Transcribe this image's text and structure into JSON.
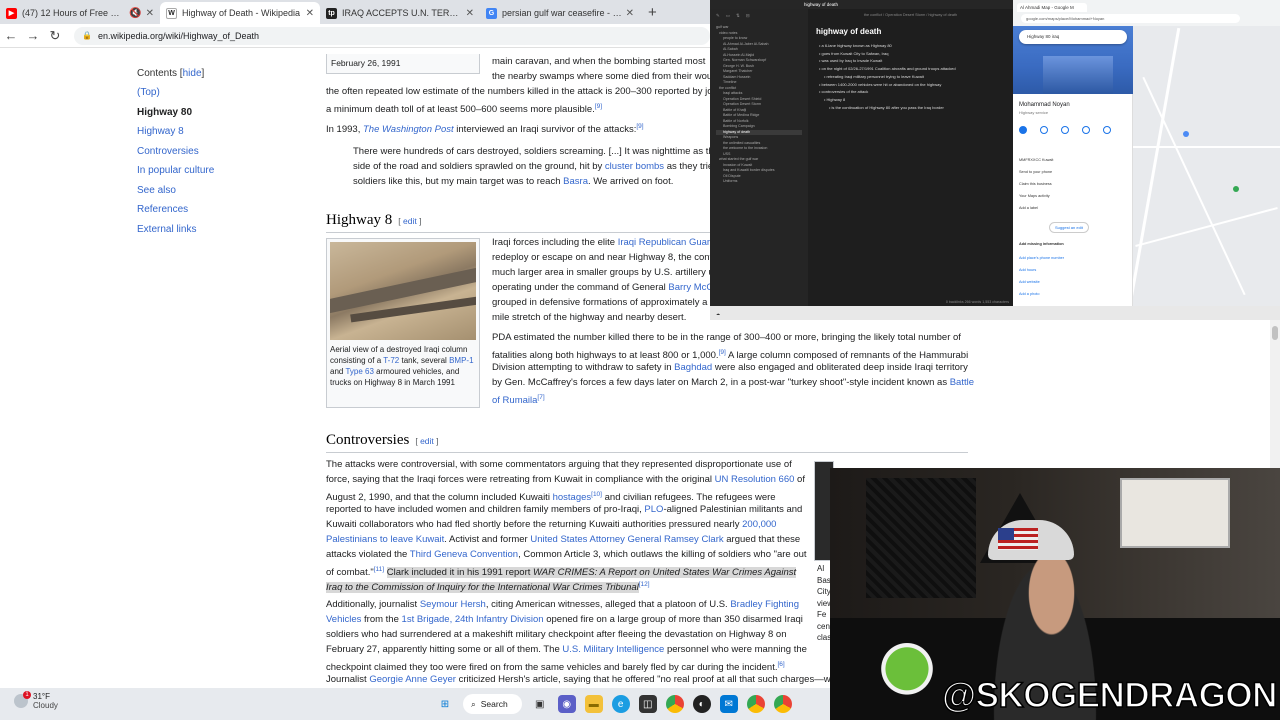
{
  "browser": {
    "tabs": [
      {
        "title": "(47) 12 Hours of Free Backg",
        "color": "#ff0000",
        "glyph": "▶"
      },
      {
        "title": "Highway of Death - Wikipedia",
        "color": "#555555",
        "glyph": "W"
      },
      {
        "title": "IRAQ ACCEPTS U.N. TERMS TO E",
        "color": "#222222",
        "glyph": "tp"
      },
      {
        "title": "persian gulf war ceasefire - Goo",
        "color": "#4285f4",
        "glyph": "G"
      }
    ],
    "url": "en.wikipedia.org/wiki/Highway_of_Death"
  },
  "toc": {
    "title": "Contents",
    "hide": "hide",
    "items": [
      "(Top)",
      "Highway 80",
      "Highway 8",
      "Controversies",
      "In popular culture",
      "See also",
      "References",
      "External links"
    ]
  },
  "article": {
    "date_line": "February 26, 1991",
    "p1a": "main caravan, and when the bombing started most",
    "p1b": "the nearby swamps where some died from their wou",
    "p1c": "the often repeated low estimate of the numbers killed in the attack is 200–300 reported by jou",
    "p1d": "a minimum death toll of at least 500–600 seems more plausible.",
    "ref9": "[9]",
    "p2_pre": "In 1993,",
    "p2_link": "The Washington Post",
    "p2_post": "interviewed an Iraqi survivor of the attacks:",
    "quote1": "There were hundreds of cars destroyed, soldiers screaming. [...] It was nighttime as th",
    "quote2_pre": "side of the road and soldiers sprawled on the ground, hit by",
    "quote2_link": "cluster bombs",
    "quote2_post": "as they trie",
    "quote3_pre": "soldiers like this, but my main target was to reach",
    "quote3_link": "Basra",
    "quote3_post": ". We arrived on foot.",
    "h_hw8": "Highway 8",
    "edit": "edit",
    "hw8_1_pre": "Iraqi forces including the elite",
    "hw8_1_link": "Iraqi Republican Guard",
    "hw8_2": "redeploy or escape on and near Highway 8, the cont",
    "hw8_3": "much larger area in smaller groups by U.S. artillery u",
    "hw8_4_pre": "operating under the command of General",
    "hw8_4_link": "Barry McC",
    "hw8_5": "grouped in defensive formations of approximately a",
    "hw8_6": "mile stretch of the highway and nearby desert.",
    "cap1": "Aerial view of a destroyed Iraqi column consisting of a",
    "cap_t72": "T-72",
    "cap2": "tank, several",
    "cap_bmp": "BMP-1",
    "cap3": "and",
    "cap_t63": "Type 63",
    "cap4": "armoured vehicles, and trucks on Highway 8 in March 1991",
    "pda1": "PDA estimated the number killed there to be in the range of 300–400 or more, bringing the likely total number of",
    "pda2": "fatalities along both highways to at least 800 or 1,000.",
    "pda2b": "A large column composed of remnants of the Hammurabi",
    "pda3_pre": "Division attempting to withdraw to safety in",
    "pda3_link": "Baghdad",
    "pda3_post": "were also engaged and obliterated deep inside Iraqi territory",
    "pda4_pre": "by Gen. McCaffrey's forces a few days later on March 2, in a post-war \"turkey shoot\"-style incident known as",
    "pda4_link": "Battle",
    "pda5_link": "of Rumaila",
    "ref7": "[7]",
    "h_contro": "Controversies",
    "c1": "The attacks were controversial, with some commentators arguing that they represented disproportionate use of",
    "c2_pre": "force, saying that the Iraqi forces were retreating from Kuwait in compliance with the original",
    "c2_link": "UN Resolution 660",
    "c2_post": "of",
    "c3_pre": "August 2, 1990, and that the column included Kuwaiti",
    "c3_link": "hostages",
    "ref10": "[10]",
    "c3_post": "and civilian refugees. The refugees were",
    "c4_pre": "reported to have included women and children family members of pro-Iraqi,",
    "c4_link": "PLO",
    "c4_post": "-aligned Palestinian militants and",
    "c5_pre": "Kuwaiti collaborators who had fled shortly before the returning Kuwaiti authorities pressured nearly",
    "c5_link": "200,000",
    "c6_link": "Palestinians to leave Kuwait",
    "c6_mid": ". Activist and former",
    "c6_link2": "United States Attorney General Ramsey Clark",
    "c6_post": "argued that these",
    "c7_pre": "attacks violated the",
    "c7_link": "Third Geneva Convention",
    "c7_post": ", Common Article 3, which outlaws the killing of soldiers who \"are out",
    "c8_pre": "of combat.\"",
    "ref11": "[11]",
    "c8_hl1": "Clark included it in his 1991 report",
    "c8_hl2": "WAR CRIMES: A Report on United States War Crimes Against",
    "c9_hl": "Iraq to the Commission of Inquiry for the International War Crimes Tribunal",
    "ref12": "[12]",
    "s1_pre": "Additionally, journalist",
    "s1_link": "Seymour Hersh",
    "s1_mid": ", citing American witnesses, alleged that a platoon of U.S.",
    "s1_link2": "Bradley Fighting",
    "s2_link": "Vehicles",
    "s2_mid": "from the",
    "s2_link2": "1st Brigade, 24th Infantry Division",
    "s2_post": "opened fire on a large group of more than 350 disarmed Iraqi",
    "s3": "soldiers who had surrendered at a makeshift military checkpoint after fleeing the devastation on Highway 8 on",
    "s4_pre": "February 27, apparently hitting some or all of them. The",
    "s4_link": "U.S. Military Intelligence",
    "s4_post": "personnel who were manning the",
    "s5": "checkpoint claimed they too were fired on from the same vehicles and barely fled by car during the incident.",
    "ref6": "[6]",
    "s6_pre": "Journalist",
    "s6_link": "Georgie Anne Geyer",
    "s6_post": "criticized Hersh's article, saying that he offered \"no real proof at all that such charges—whi",
    "side_caption": [
      "Al",
      "Bas",
      "City",
      "view",
      "Fe",
      "cen",
      "clas"
    ]
  },
  "notes": {
    "crumb": "the conflict / Operation Desert Storm / highway of death",
    "title": "highway of death",
    "files": [
      "gulf war",
      "video notes",
      "people to know",
      "Al-Ahmad Al-Jaber Al-Sabah",
      "Al-Sabah",
      "Al-Hussein Al-Majid",
      "Gen. Norman Schwarzkopf",
      "George H. W. Bush",
      "Margaret Thatcher",
      "Saddam Hussein",
      "Timeline",
      "the conflict",
      "Iraqi attacks",
      "Operation Desert Shield",
      "Operation Desert Storm",
      "Battle of Khafji",
      "Battle of Medina Ridge",
      "Battle of Norfolk",
      "Bombing Campaign",
      "highway of death",
      "Weapons",
      "the unlimited casualties",
      "the welcome to the invasion",
      "USS",
      "what started the gulf war",
      "Invasion of Kuwait",
      "Iraq and Kuwaiti border disputes",
      "Oil Dispute",
      "Uniforms"
    ],
    "lines": [
      {
        "t": "a 6-lane highway known as Highway 80",
        "lvl": 0
      },
      {
        "t": "goes from Kuwait City to Safwan, Iraq",
        "lvl": 0
      },
      {
        "t": "was used by Iraq to invade Kuwait",
        "lvl": 0
      },
      {
        "t": "on the night of 02/26-27/1991 Coalition aircrafts and ground troops attacked",
        "lvl": 0
      },
      {
        "t": "retreating Iraqi military personnel trying to leave Kuwait",
        "lvl": 1
      },
      {
        "t": "between 1400-2000 vehicles were hit or abandoned on the highway",
        "lvl": 0
      },
      {
        "t": "controversies of the attack",
        "lvl": 0
      },
      {
        "t": "Highway 8",
        "lvl": 1
      },
      {
        "t": "is the continuation of Highway 80 after you pass the Iraq border",
        "lvl": 2
      }
    ],
    "status": "0 backlinks   266 words   1,553 characters"
  },
  "maps": {
    "tab": "Al Ahmadi Map - Google M",
    "addr": "google.com/maps/place/Mohammad+Noyan",
    "search": "Highway 80 iraq",
    "place": "Mohammad Noyan",
    "sub": "Highway service",
    "rows": [
      "MMFRXXCC Kuwait",
      "Send to your phone",
      "Claim this business",
      "Your Maps activity",
      "Add a label"
    ],
    "suggest": "Suggest an edit",
    "missing": "Add missing information",
    "missing_rows": [
      "Add place's phone number",
      "Add hours",
      "Add website",
      "Add a photo"
    ]
  },
  "taskbar": {
    "temp": "31°F",
    "cond": "Cloudy",
    "badge": "1",
    "search": "Search"
  },
  "stream": {
    "handle": "@SKOGENDRAGON"
  }
}
